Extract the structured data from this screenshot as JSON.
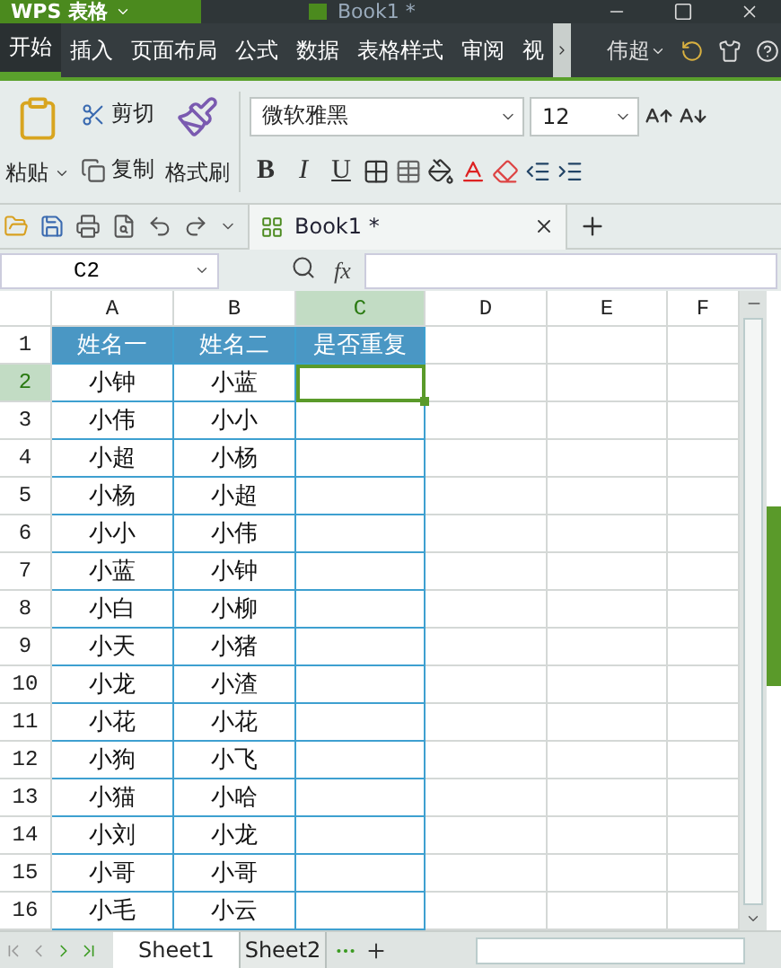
{
  "title_bar": {
    "app": "WPS 表格",
    "document_tab": "Book1 *"
  },
  "menu": [
    {
      "label": "开始",
      "selected": true
    },
    {
      "label": "插入",
      "selected": false
    },
    {
      "label": "页面布局",
      "selected": false
    },
    {
      "label": "公式",
      "selected": false
    },
    {
      "label": "数据",
      "selected": false
    },
    {
      "label": "表格样式",
      "selected": false
    },
    {
      "label": "审阅",
      "selected": false
    },
    {
      "label": "视",
      "selected": false
    }
  ],
  "user": "伟超",
  "ribbon": {
    "paste": "粘贴",
    "cut": "剪切",
    "copy": "复制",
    "format_painter": "格式刷",
    "font": "微软雅黑",
    "font_size": "12",
    "bold": "B",
    "italic": "I",
    "underline": "U"
  },
  "document_tabs": [
    {
      "label": "Book1 *",
      "selected": true
    }
  ],
  "name_box": "C2",
  "formula_label": "fx",
  "columns": [
    {
      "label": "A",
      "selected": false
    },
    {
      "label": "B",
      "selected": false
    },
    {
      "label": "C",
      "selected": true
    },
    {
      "label": "D",
      "selected": false
    },
    {
      "label": "E",
      "selected": false
    },
    {
      "label": "F",
      "selected": false
    }
  ],
  "header_row": {
    "number": "1",
    "cells": [
      "姓名一",
      "姓名二",
      "是否重复"
    ]
  },
  "rows": [
    {
      "number": "2",
      "selected": true,
      "cells": [
        "小钟",
        "小蓝"
      ]
    },
    {
      "number": "3",
      "selected": false,
      "cells": [
        "小伟",
        "小小"
      ]
    },
    {
      "number": "4",
      "selected": false,
      "cells": [
        "小超",
        "小杨"
      ]
    },
    {
      "number": "5",
      "selected": false,
      "cells": [
        "小杨",
        "小超"
      ]
    },
    {
      "number": "6",
      "selected": false,
      "cells": [
        "小小",
        "小伟"
      ]
    },
    {
      "number": "7",
      "selected": false,
      "cells": [
        "小蓝",
        "小钟"
      ]
    },
    {
      "number": "8",
      "selected": false,
      "cells": [
        "小白",
        "小柳"
      ]
    },
    {
      "number": "9",
      "selected": false,
      "cells": [
        "小天",
        "小猪"
      ]
    },
    {
      "number": "10",
      "selected": false,
      "cells": [
        "小龙",
        "小渣"
      ]
    },
    {
      "number": "11",
      "selected": false,
      "cells": [
        "小花",
        "小花"
      ]
    },
    {
      "number": "12",
      "selected": false,
      "cells": [
        "小狗",
        "小飞"
      ]
    },
    {
      "number": "13",
      "selected": false,
      "cells": [
        "小猫",
        "小哈"
      ]
    },
    {
      "number": "14",
      "selected": false,
      "cells": [
        "小刘",
        "小龙"
      ]
    },
    {
      "number": "15",
      "selected": false,
      "cells": [
        "小哥",
        "小哥"
      ]
    },
    {
      "number": "16",
      "selected": false,
      "cells": [
        "小毛",
        "小云"
      ]
    }
  ],
  "sheet_tabs": [
    {
      "label": "Sheet1",
      "selected": true
    },
    {
      "label": "Sheet2",
      "selected": false
    }
  ]
}
